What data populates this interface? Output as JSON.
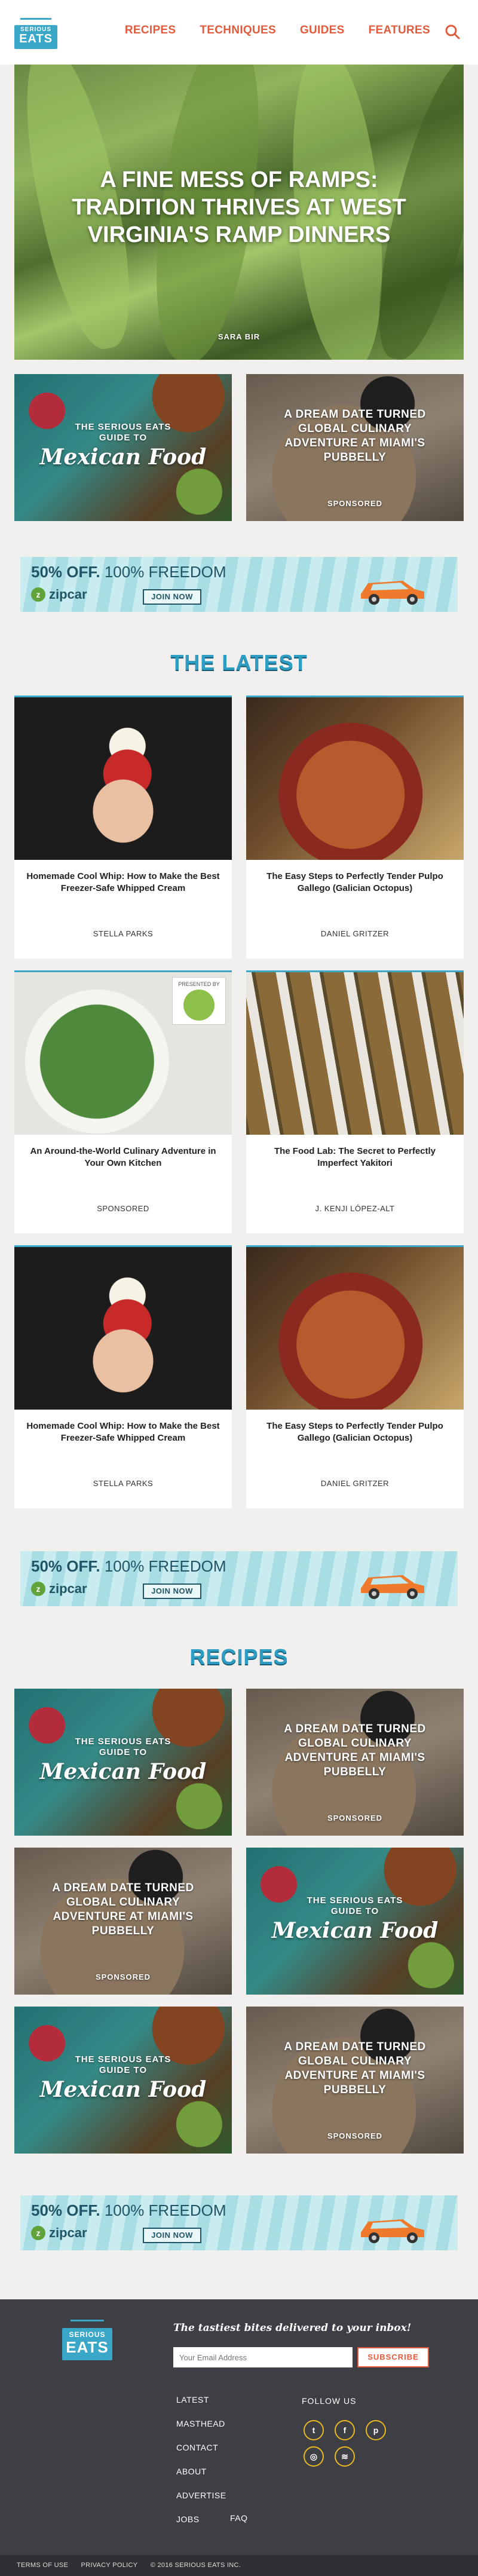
{
  "header": {
    "logo_top": "SERIOUS",
    "logo_bottom": "EATS",
    "nav": [
      "RECIPES",
      "TECHNIQUES",
      "GUIDES",
      "FEATURES"
    ]
  },
  "hero": {
    "title": "A FINE MESS OF RAMPS: TRADITION THRIVES AT WEST VIRGINIA'S RAMP DINNERS",
    "author": "SARA BIR"
  },
  "promos": {
    "mexican": {
      "line1": "THE SERIOUS EATS",
      "line2": "GUIDE TO",
      "script": "Mexican Food"
    },
    "dinner": {
      "title": "A DREAM DATE TURNED GLOBAL CULINARY ADVENTURE AT MIAMI'S PUBBELLY",
      "label": "SPONSORED"
    }
  },
  "ad": {
    "headline_bold": "50% OFF.",
    "headline_rest": " 100% FREEDOM",
    "brand": "zipcar",
    "brand_mark": "z",
    "cta": "JOIN NOW"
  },
  "latest": {
    "heading": "THE LATEST",
    "cards": [
      {
        "title": "Homemade Cool Whip: How to Make the Best Freezer-Safe Whipped Cream",
        "byline": "STELLA PARKS"
      },
      {
        "title": "The Easy Steps to Perfectly Tender Pulpo Gallego (Galician Octopus)",
        "byline": "DANIEL GRITZER"
      },
      {
        "title": "An Around-the-World Culinary Adventure in Your Own Kitchen",
        "byline": "SPONSORED",
        "badge": "PRESENTED BY"
      },
      {
        "title": "The Food Lab: The Secret to Perfectly Imperfect Yakitori",
        "byline": "J. KENJI LÓPEZ-ALT"
      },
      {
        "title": "Homemade Cool Whip: How to Make the Best Freezer-Safe Whipped Cream",
        "byline": "STELLA PARKS"
      },
      {
        "title": "The Easy Steps to Perfectly Tender Pulpo Gallego (Galician Octopus)",
        "byline": "DANIEL GRITZER"
      }
    ]
  },
  "recipes": {
    "heading": "RECIPES"
  },
  "footer": {
    "tagline": "The tastiest bites delivered to your inbox!",
    "email_placeholder": "Your Email Address",
    "subscribe": "SUBSCRIBE",
    "links": [
      "LATEST",
      "MASTHEAD",
      "CONTACT",
      "ABOUT",
      "ADVERTISE",
      "JOBS"
    ],
    "faq": "FAQ",
    "follow": "FOLLOW US",
    "legal": [
      "TERMS OF USE",
      "PRIVACY POLICY",
      "© 2016 SERIOUS EATS INC."
    ]
  }
}
